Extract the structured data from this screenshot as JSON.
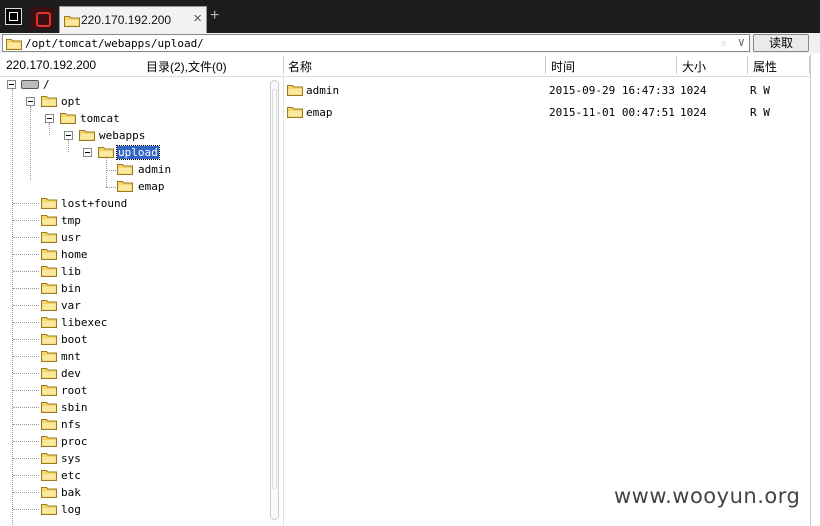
{
  "tab": {
    "title": "220.170.192.200",
    "close": "×",
    "add": "+"
  },
  "address": {
    "path": "/opt/tomcat/webapps/upload/",
    "star": "☆",
    "dropdown": "∨"
  },
  "read_button": "读取",
  "info": {
    "host": "220.170.192.200",
    "summary": "目录(2),文件(0)"
  },
  "columns": {
    "name": "名称",
    "time": "时间",
    "size": "大小",
    "attr": "属性"
  },
  "tree": {
    "root": "/",
    "opt": "opt",
    "tomcat": "tomcat",
    "webapps": "webapps",
    "upload": "upload",
    "upload_children": [
      "admin",
      "emap"
    ],
    "root_dirs": [
      "lost+found",
      "tmp",
      "usr",
      "home",
      "lib",
      "bin",
      "var",
      "libexec",
      "boot",
      "mnt",
      "dev",
      "root",
      "sbin",
      "nfs",
      "proc",
      "sys",
      "etc",
      "bak",
      "log"
    ]
  },
  "files": [
    {
      "name": "admin",
      "time": "2015-09-29 16:47:33",
      "size": "1024",
      "attr": "R W"
    },
    {
      "name": "emap",
      "time": "2015-11-01 00:47:51",
      "size": "1024",
      "attr": "R W"
    }
  ],
  "watermark": "www.wooyun.org",
  "colors": {
    "selection": "#3165c6",
    "folder": "#f5d46a",
    "tabbar": "#1d1d1d"
  }
}
